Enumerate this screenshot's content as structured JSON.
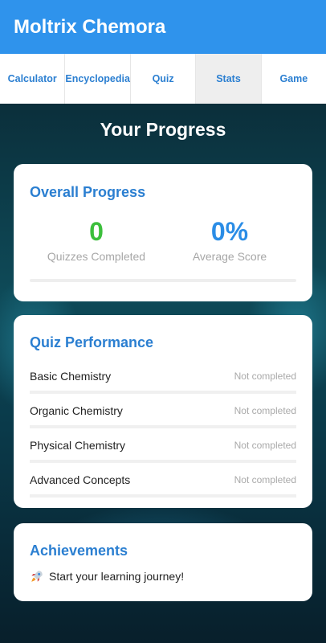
{
  "app": {
    "title": "Moltrix Chemora"
  },
  "tabs": [
    {
      "label": "Calculator",
      "active": false
    },
    {
      "label": "Encyclopedia",
      "active": false
    },
    {
      "label": "Quiz",
      "active": false
    },
    {
      "label": "Stats",
      "active": true
    },
    {
      "label": "Game",
      "active": false
    }
  ],
  "page": {
    "title": "Your Progress"
  },
  "overall": {
    "title": "Overall Progress",
    "quizzes_completed": {
      "value": "0",
      "label": "Quizzes Completed"
    },
    "average_score": {
      "value": "0%",
      "label": "Average Score"
    },
    "progress_fraction": 0
  },
  "quiz_performance": {
    "title": "Quiz Performance",
    "items": [
      {
        "name": "Basic Chemistry",
        "status": "Not completed"
      },
      {
        "name": "Organic Chemistry",
        "status": "Not completed"
      },
      {
        "name": "Physical Chemistry",
        "status": "Not completed"
      },
      {
        "name": "Advanced Concepts",
        "status": "Not completed"
      }
    ]
  },
  "achievements": {
    "title": "Achievements",
    "items": [
      {
        "icon": "rocket-icon",
        "text": "Start your learning journey!"
      }
    ]
  },
  "colors": {
    "app_bar": "#2f93ec",
    "accent": "#2b7fd1",
    "success": "#3cbf3c"
  }
}
